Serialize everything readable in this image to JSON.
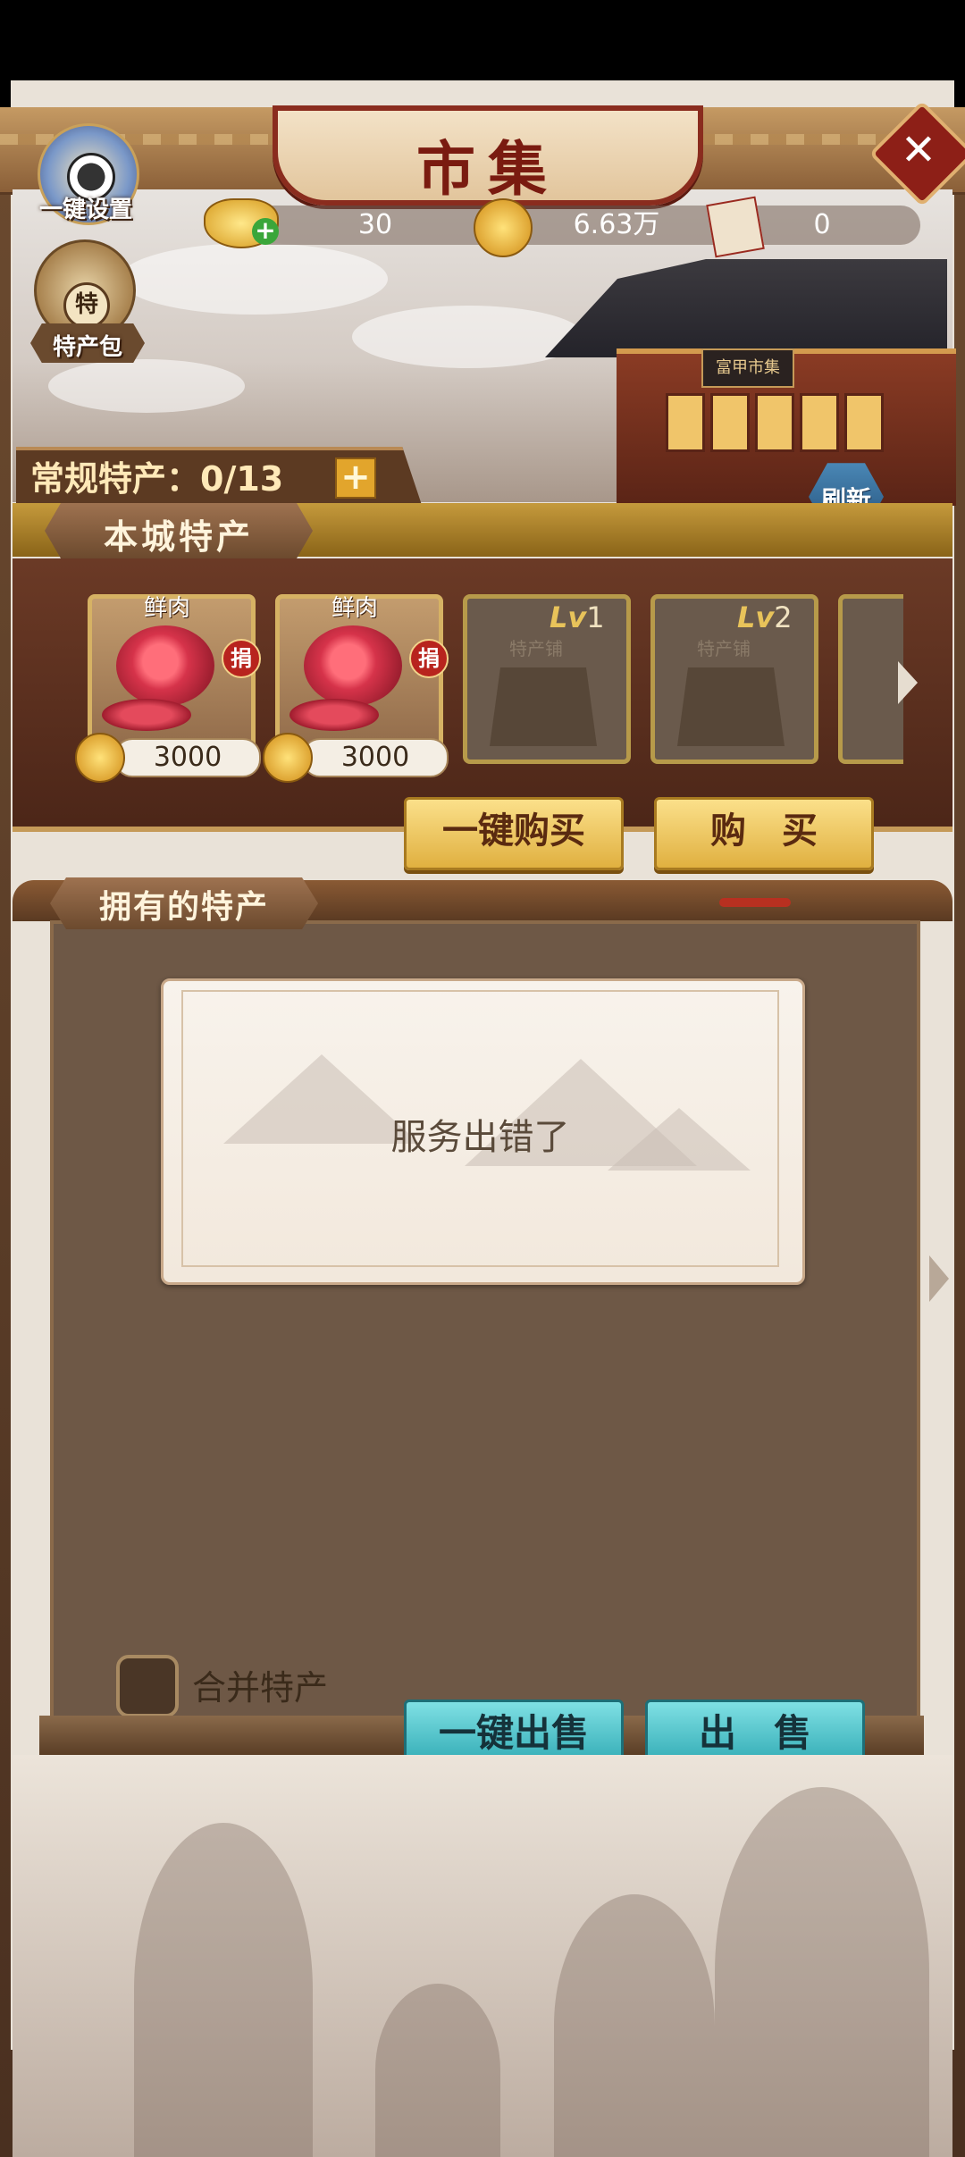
{
  "header": {
    "title": "市集",
    "one_key_setting_label": "一键设置",
    "special_bag_label": "特产包",
    "special_bag_badge": "特",
    "close_icon": "close-icon"
  },
  "currency": {
    "ingot": "30",
    "coins": "6.63万",
    "ticket": "0"
  },
  "normal_special": {
    "label": "常规特产：",
    "count": "0/13",
    "plus": "+"
  },
  "refresh_label": "刷新",
  "building_sign": "富甲市集",
  "local_section": {
    "title": "本城特产",
    "items": [
      {
        "name": "鲜肉",
        "price": "3000",
        "badge": "捐"
      },
      {
        "name": "鲜肉",
        "price": "3000",
        "badge": "捐"
      }
    ],
    "locked": [
      {
        "lv_prefix": "Lv",
        "lv_num": "1",
        "label": "特产铺"
      },
      {
        "lv_prefix": "Lv",
        "lv_num": "2",
        "label": "特产铺"
      }
    ],
    "buy_all_label": "一键购买",
    "buy_label": "购　买"
  },
  "owned_section": {
    "title": "拥有的特产",
    "error_message": "服务出错了",
    "merge_label": "合并特产",
    "sell_all_label": "一键出售",
    "sell_label": "出　售"
  },
  "colors": {
    "frame_brown": "#6b4a2f",
    "title_red": "#7a1b10",
    "gold_button": "#e0b040",
    "teal_button": "#2aa6b0"
  }
}
